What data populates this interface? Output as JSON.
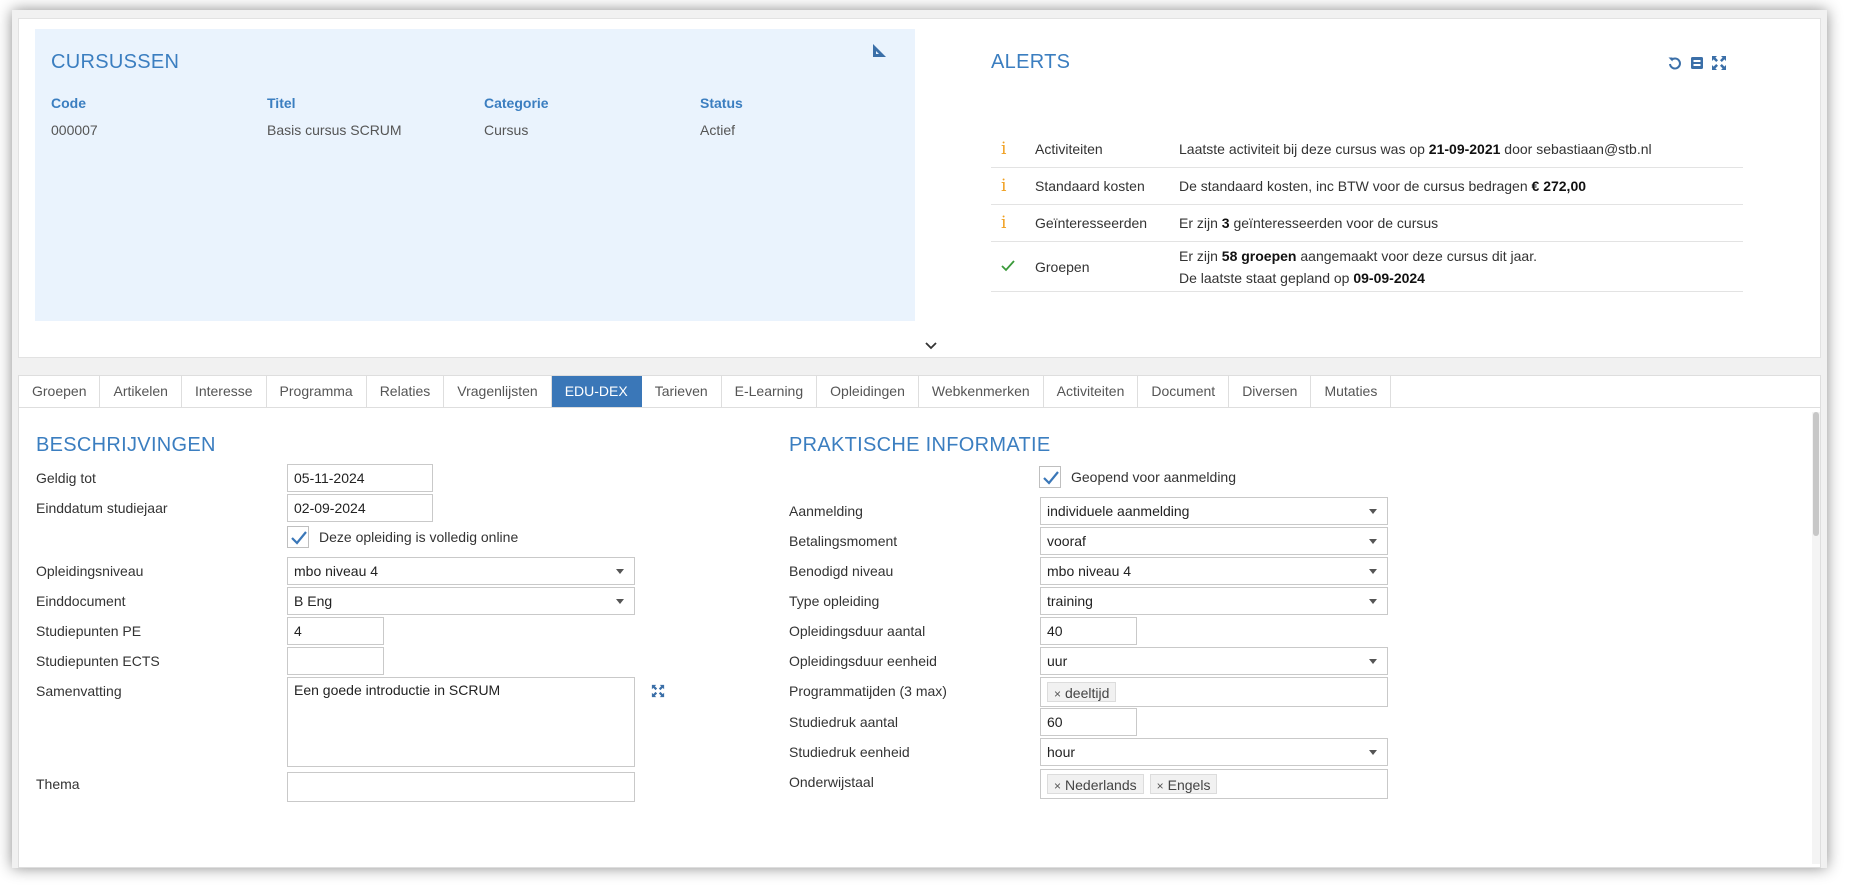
{
  "courses": {
    "title": "CURSUSSEN",
    "columns": [
      "Code",
      "Titel",
      "Categorie",
      "Status"
    ],
    "row": [
      "000007",
      "Basis cursus SCRUM",
      "Cursus",
      "Actief"
    ]
  },
  "alerts": {
    "title": "ALERTS",
    "items": [
      {
        "icon": "info-icon",
        "label": "Activiteiten",
        "msg_pre": "Laatste activiteit bij deze cursus was op ",
        "msg_bold": "21-09-2021",
        "msg_post": " door sebastiaan@stb.nl"
      },
      {
        "icon": "info-icon",
        "label": "Standaard kosten",
        "msg_pre": "De standaard kosten, inc BTW voor de cursus bedragen ",
        "msg_bold": "€ 272,00",
        "msg_post": ""
      },
      {
        "icon": "info-icon",
        "label": "Geïnteresseerden",
        "msg_pre": "Er zijn ",
        "msg_bold": "3",
        "msg_post": " geïnteresseerden voor de cursus"
      },
      {
        "icon": "check-icon",
        "label": "Groepen",
        "msg_pre": "Er zijn ",
        "msg_bold": "58 groepen",
        "msg_post": " aangemaakt voor deze cursus dit jaar.",
        "msg2_pre": "De laatste staat gepland op ",
        "msg2_bold": "09-09-2024"
      }
    ]
  },
  "tabs": [
    "Groepen",
    "Artikelen",
    "Interesse",
    "Programma",
    "Relaties",
    "Vragenlijsten",
    "EDU-DEX",
    "Tarieven",
    "E-Learning",
    "Opleidingen",
    "Webkenmerken",
    "Activiteiten",
    "Document",
    "Diversen",
    "Mutaties"
  ],
  "active_tab": "EDU-DEX",
  "beschrijvingen": {
    "title": "BESCHRIJVINGEN",
    "geldig_tot": {
      "label": "Geldig tot",
      "value": "05-11-2024"
    },
    "einddatum": {
      "label": "Einddatum studiejaar",
      "value": "02-09-2024"
    },
    "online": {
      "label": "Deze opleiding is volledig online",
      "checked": true
    },
    "opleidingsniveau": {
      "label": "Opleidingsniveau",
      "value": "mbo niveau 4"
    },
    "einddocument": {
      "label": "Einddocument",
      "value": "B Eng"
    },
    "pe": {
      "label": "Studiepunten PE",
      "value": "4"
    },
    "ects": {
      "label": "Studiepunten ECTS",
      "value": ""
    },
    "samenvatting": {
      "label": "Samenvatting",
      "value": "Een goede introductie in SCRUM"
    },
    "thema": {
      "label": "Thema"
    }
  },
  "praktisch": {
    "title": "PRAKTISCHE INFORMATIE",
    "geopend": {
      "label": "Geopend voor aanmelding",
      "checked": true
    },
    "aanmelding": {
      "label": "Aanmelding",
      "value": "individuele aanmelding"
    },
    "betalingsmoment": {
      "label": "Betalingsmoment",
      "value": "vooraf"
    },
    "benodigd_niveau": {
      "label": "Benodigd niveau",
      "value": "mbo niveau 4"
    },
    "type": {
      "label": "Type opleiding",
      "value": "training"
    },
    "duur_aantal": {
      "label": "Opleidingsduur aantal",
      "value": "40"
    },
    "duur_eenheid": {
      "label": "Opleidingsduur eenheid",
      "value": "uur"
    },
    "programmatijden": {
      "label": "Programmatijden (3 max)",
      "tags": [
        "deeltijd"
      ]
    },
    "studiedruk_aantal": {
      "label": "Studiedruk aantal",
      "value": "60"
    },
    "studiedruk_eenheid": {
      "label": "Studiedruk eenheid",
      "value": "hour"
    },
    "onderwijstaal": {
      "label": "Onderwijstaal",
      "tags": [
        "Nederlands",
        "Engels"
      ]
    }
  },
  "colors": {
    "accent": "#3b7ec0",
    "active_tab": "#3a77b8",
    "panel_bg": "#eaf3fd",
    "info": "#f0a020",
    "ok": "#3a9a3a"
  }
}
